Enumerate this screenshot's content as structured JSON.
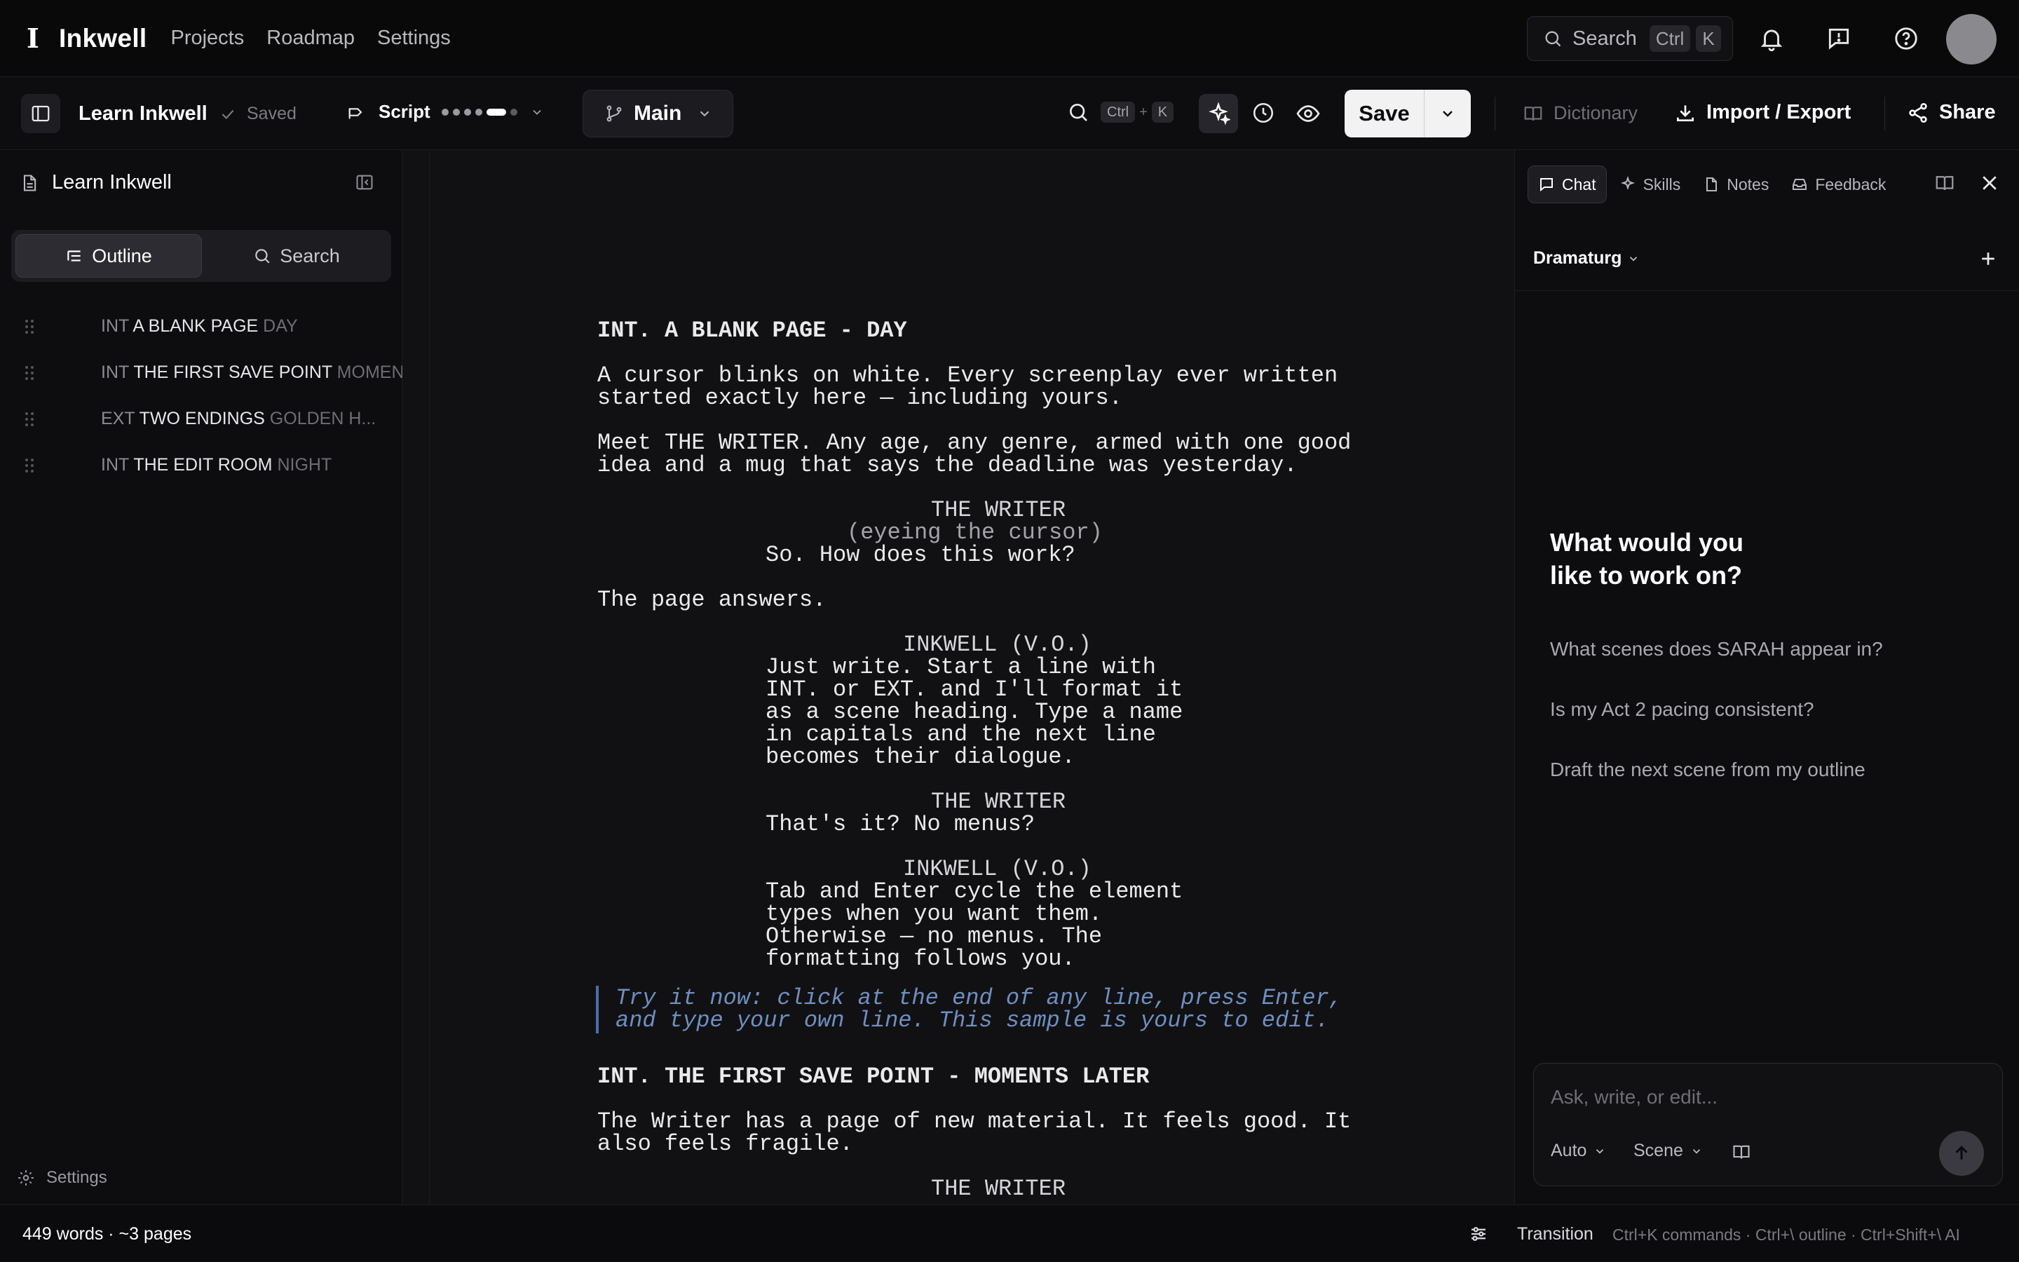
{
  "app": {
    "brand_mark": "I",
    "brand_name": "Inkwell",
    "nav": [
      "Projects",
      "Roadmap",
      "Settings"
    ],
    "search": {
      "label": "Search",
      "kbd1": "Ctrl",
      "kbd2": "K"
    }
  },
  "toolbar": {
    "doc_title": "Learn Inkwell",
    "saved_status": "Saved",
    "mode_label": "Script",
    "branch_label": "Main",
    "shortcut_kbd1": "Ctrl",
    "shortcut_plus": "+",
    "shortcut_kbd2": "K",
    "save_label": "Save",
    "dictionary_label": "Dictionary",
    "import_export_label": "Import / Export",
    "share_label": "Share"
  },
  "sidebar": {
    "title": "Learn Inkwell",
    "tabs": [
      "Outline",
      "Search"
    ],
    "outline": [
      {
        "prefix": "INT",
        "name": "A BLANK PAGE",
        "time": "DAY"
      },
      {
        "prefix": "INT",
        "name": "THE FIRST SAVE POINT",
        "time": "MOMENTS"
      },
      {
        "prefix": "EXT",
        "name": "TWO ENDINGS",
        "time": "GOLDEN H..."
      },
      {
        "prefix": "INT",
        "name": "THE EDIT ROOM",
        "time": "NIGHT"
      }
    ],
    "settings_label": "Settings"
  },
  "script": {
    "lines": [
      "INT. A BLANK PAGE - DAY",
      "A cursor blinks on white. Every screenplay ever written",
      "started exactly here — including yours.",
      "Meet THE WRITER. Any age, any genre, armed with one good",
      "idea and a mug that says the deadline was yesterday.",
      "THE WRITER",
      "(eyeing the cursor)",
      "So. How does this work?",
      "The page answers.",
      "INKWELL (V.O.)",
      "Just write. Start a line with",
      "INT. or EXT. and I'll format it",
      "as a scene heading. Type a name",
      "in capitals and the next line",
      "becomes their dialogue.",
      "THE WRITER",
      "That's it? No menus?",
      "INKWELL (V.O.)",
      "Tab and Enter cycle the element",
      "types when you want them.",
      "Otherwise — no menus. The",
      "formatting follows you.",
      "Try it now: click at the end of any line, press Enter,",
      "and type your own line. This sample is yours to edit.",
      "INT. THE FIRST SAVE POINT - MOMENTS LATER",
      "The Writer has a page of new material. It feels good. It",
      "also feels fragile.",
      "THE WRITER"
    ]
  },
  "panel": {
    "tabs": [
      "Chat",
      "Skills",
      "Notes",
      "Feedback"
    ],
    "agent": "Dramaturg",
    "welcome": "What would you like to work on?",
    "suggestions": [
      "What scenes does SARAH appear in?",
      "Is my Act 2 pacing consistent?",
      "Draft the next scene from my outline"
    ],
    "composer_placeholder": "Ask, write, or edit...",
    "composer_mode": "Auto",
    "composer_scope": "Scene"
  },
  "status": {
    "word_count": "449 words · ~3 pages",
    "element_type": "Transition",
    "hints": "Ctrl+K commands · Ctrl+\\ outline · Ctrl+Shift+\\ AI"
  },
  "colors": {
    "accent_tip": "#6f8fc0",
    "background": "#0b0b0d",
    "save_button": "#f2f2f3"
  }
}
